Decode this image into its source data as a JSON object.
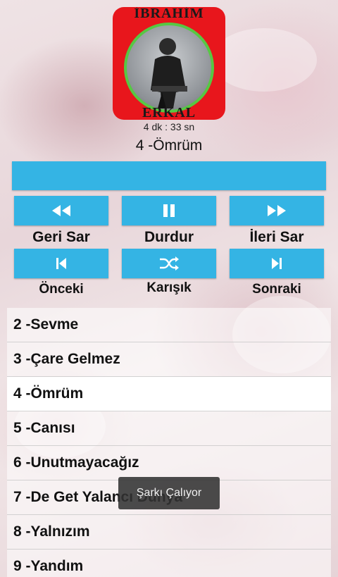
{
  "album": {
    "artist_top": "İBRAHİM",
    "artist_bottom": "ERKAL"
  },
  "player": {
    "duration": "4 dk : 33 sn",
    "current_track": "4 -Ömrüm"
  },
  "controls": {
    "rewind_label": "Geri Sar",
    "pause_label": "Durdur",
    "forward_label": "İleri Sar",
    "previous_label": "Önceki",
    "shuffle_label": "Karışık",
    "next_label": "Sonraki"
  },
  "tracks": [
    {
      "label": "2 -Sevme"
    },
    {
      "label": "3 -Çare Gelmez"
    },
    {
      "label": "4 -Ömrüm",
      "selected": true
    },
    {
      "label": "5 -Canısı"
    },
    {
      "label": "6 -Unutmayacağız"
    },
    {
      "label": "7 -De Get Yalancı Dünya"
    },
    {
      "label": "8 -Yalnızım"
    },
    {
      "label": "9 -Yandım"
    }
  ],
  "toast": "Şarkı Çalıyor",
  "colors": {
    "accent": "#34b4e4",
    "cover_red": "#e8161c",
    "cover_ring": "#57c843"
  }
}
